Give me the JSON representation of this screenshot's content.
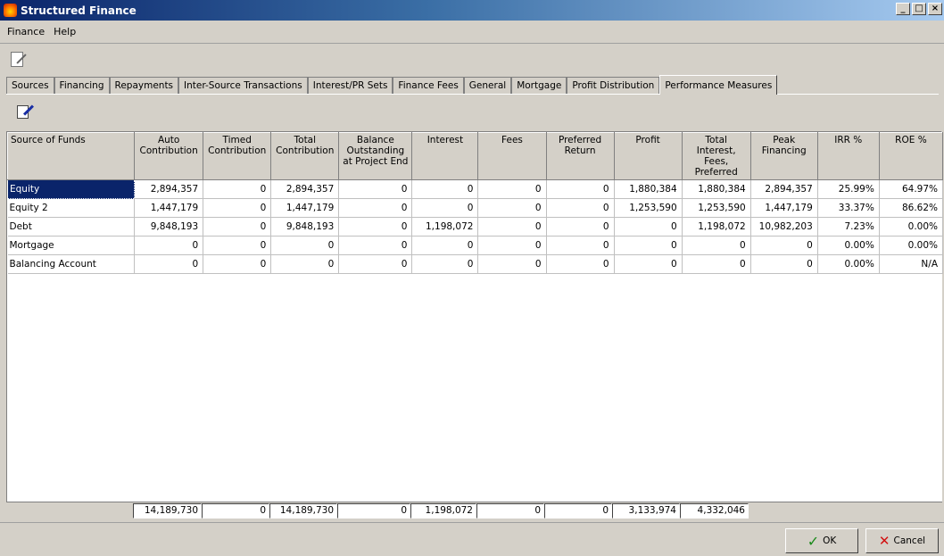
{
  "window": {
    "title": "Structured Finance",
    "minimize": "_",
    "maximize": "□",
    "close": "×"
  },
  "menu": [
    {
      "label": "Finance"
    },
    {
      "label": "Help"
    }
  ],
  "tabs": [
    {
      "label": "Sources"
    },
    {
      "label": "Financing"
    },
    {
      "label": "Repayments"
    },
    {
      "label": "Inter-Source Transactions"
    },
    {
      "label": "Interest/PR Sets"
    },
    {
      "label": "Finance Fees"
    },
    {
      "label": "General"
    },
    {
      "label": "Mortgage"
    },
    {
      "label": "Profit Distribution"
    },
    {
      "label": "Performance Measures"
    }
  ],
  "active_tab": "Performance Measures",
  "grid": {
    "headers": [
      "Source of Funds",
      "Auto Contribution",
      "Timed Contribution",
      "Total Contribution",
      "Balance Outstanding at Project End",
      "Interest",
      "Fees",
      "Preferred Return",
      "Profit",
      "Total Interest, Fees, Preferred",
      "Peak Financing",
      "IRR %",
      "ROE %"
    ],
    "rows": [
      [
        "Equity",
        "2,894,357",
        "0",
        "2,894,357",
        "0",
        "0",
        "0",
        "0",
        "1,880,384",
        "1,880,384",
        "2,894,357",
        "25.99%",
        "64.97%"
      ],
      [
        "Equity 2",
        "1,447,179",
        "0",
        "1,447,179",
        "0",
        "0",
        "0",
        "0",
        "1,253,590",
        "1,253,590",
        "1,447,179",
        "33.37%",
        "86.62%"
      ],
      [
        "Debt",
        "9,848,193",
        "0",
        "9,848,193",
        "0",
        "1,198,072",
        "0",
        "0",
        "0",
        "1,198,072",
        "10,982,203",
        "7.23%",
        "0.00%"
      ],
      [
        "Mortgage",
        "0",
        "0",
        "0",
        "0",
        "0",
        "0",
        "0",
        "0",
        "0",
        "0",
        "0.00%",
        "0.00%"
      ],
      [
        "Balancing Account",
        "0",
        "0",
        "0",
        "0",
        "0",
        "0",
        "0",
        "0",
        "0",
        "0",
        "0.00%",
        "N/A"
      ]
    ],
    "totals": [
      "14,189,730",
      "0",
      "14,189,730",
      "0",
      "1,198,072",
      "0",
      "0",
      "3,133,974",
      "4,332,046"
    ]
  },
  "buttons": {
    "ok": "OK",
    "cancel": "Cancel"
  }
}
